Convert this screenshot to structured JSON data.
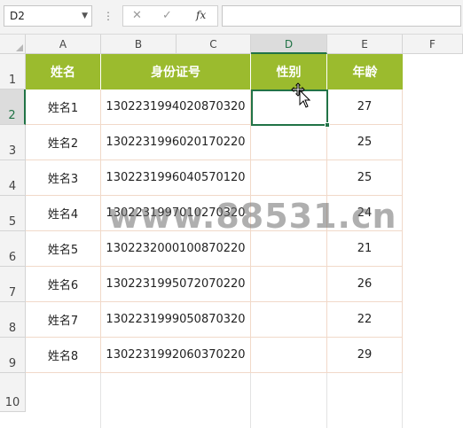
{
  "formula_bar": {
    "name_box": "D2",
    "dropdown_glyph": "▼",
    "more_glyph": "⋮",
    "cancel_glyph": "✕",
    "enter_glyph": "✓",
    "fx_glyph": "fx",
    "formula_value": ""
  },
  "columns": [
    {
      "letter": "A"
    },
    {
      "letter": "B"
    },
    {
      "letter": "C"
    },
    {
      "letter": "D"
    },
    {
      "letter": "E"
    },
    {
      "letter": "F"
    }
  ],
  "rows": [
    "1",
    "2",
    "3",
    "4",
    "5",
    "6",
    "7",
    "8",
    "9",
    "10"
  ],
  "table": {
    "headers": [
      "姓名",
      "身份证号",
      "性别",
      "年龄"
    ],
    "records": [
      {
        "name": "姓名1",
        "id": "1302231994020870320",
        "gender": "",
        "age": "27"
      },
      {
        "name": "姓名2",
        "id": "1302231996020170220",
        "gender": "",
        "age": "25"
      },
      {
        "name": "姓名3",
        "id": "1302231996040570120",
        "gender": "",
        "age": "25"
      },
      {
        "name": "姓名4",
        "id": "1302231997010270320",
        "gender": "",
        "age": "24"
      },
      {
        "name": "姓名5",
        "id": "1302232000100870220",
        "gender": "",
        "age": "21"
      },
      {
        "name": "姓名6",
        "id": "1302231995072070220",
        "gender": "",
        "age": "26"
      },
      {
        "name": "姓名7",
        "id": "1302231999050870320",
        "gender": "",
        "age": "22"
      },
      {
        "name": "姓名8",
        "id": "1302231992060370220",
        "gender": "",
        "age": "29"
      }
    ]
  },
  "selected_cell": "D2",
  "watermark": "www.88531.cn",
  "colors": {
    "header_fill": "#9bbb2e",
    "selection": "#217346",
    "grid_border": "#f1d9c9"
  }
}
